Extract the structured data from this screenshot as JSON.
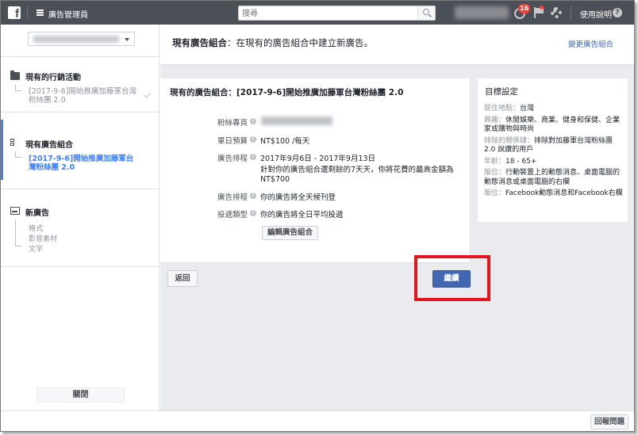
{
  "topbar": {
    "app_title": "廣告管理員",
    "search_placeholder": "搜尋",
    "notification_count": "16",
    "help_label": "使用說明",
    "help_icon_glyph": "?"
  },
  "sidebar": {
    "campaign_section_title": "現有的行銷活動",
    "campaign_item": "[2017-9-6]開始推廣加藤軍台灣粉絲團 2.0",
    "adset_section_title": "現有廣告組合",
    "adset_item": "[2017-9-6]開始推廣加藤軍台灣粉絲團 2.0",
    "ad_section_title": "新廣告",
    "ad_sub_items": [
      "格式",
      "影音素材",
      "文字"
    ],
    "close_label": "關閉"
  },
  "main": {
    "header_title_bold": "現有廣告組合",
    "header_title_rest": "：在現有的廣告組合中建立新廣告。",
    "change_adset_link": "變更廣告組合",
    "card_title": "現有的廣告組合：[2017-9-6]開始推廣加藤軍台灣粉絲團 2.0",
    "rows": {
      "fanpage_label": "粉絲專頁",
      "budget_label": "單日預算",
      "budget_value": "NT$100 /每天",
      "schedule_label": "廣告排程",
      "schedule_value": "2017年9月6日 - 2017年9月13日",
      "schedule_note": "針對你的廣告組合還剩餘的7天天，你將花費的最高金額為 NT$700",
      "delivery_label": "廣告排程",
      "delivery_value": "你的廣告將全天候刊登",
      "pacing_label": "投遞類型",
      "pacing_value": "你的廣告將全日平均投遞",
      "info_glyph": "i"
    },
    "edit_button": "編輯廣告組合",
    "target": {
      "title": "目標設定",
      "items": [
        {
          "label": "居住地點：",
          "value": "台灣"
        },
        {
          "label": "興趣：",
          "value": "休閒娛樂、商業、健身和保健、企業家或購物與時尚"
        },
        {
          "label": "排除的關係鏈：",
          "value": "排除對加藤軍台灣粉絲團 2.0 說讚的用戶"
        },
        {
          "label": "年齡：",
          "value": "18 - 65+"
        },
        {
          "label": "版位：",
          "value": "行動裝置上的動態消息、桌面電腦的動態消息或桌面電腦的右欄"
        },
        {
          "label": "版位：",
          "value": "Facebook動態消息和Facebook右欄"
        }
      ]
    },
    "back_button": "返回",
    "continue_button": "繼續"
  },
  "bottombar": {
    "report_button": "回報問題"
  },
  "colors": {
    "topbar": "#4b4f56",
    "primary_button": "#4267b2",
    "link": "#4267b2",
    "active_nav": "#4080ff",
    "highlight_annotation": "#e2141d"
  }
}
